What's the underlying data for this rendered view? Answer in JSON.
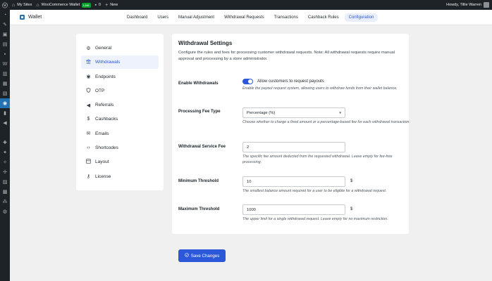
{
  "adminbar": {
    "my_sites": "My Sites",
    "site_name": "WooCommerce Wallet",
    "live_badge": "Live",
    "comments_count": "0",
    "new_label": "New",
    "howdy": "Howdy, Tillie Warren"
  },
  "plugin": {
    "title": "Wallet",
    "tabs": [
      {
        "label": "Dashboard"
      },
      {
        "label": "Users"
      },
      {
        "label": "Manual Adjustment"
      },
      {
        "label": "Withdrawal Requests"
      },
      {
        "label": "Transactions"
      },
      {
        "label": "Cashback Rules"
      },
      {
        "label": "Configuration"
      }
    ],
    "active_tab": "Configuration"
  },
  "sidebar": {
    "items": [
      {
        "label": "General",
        "icon": "gear-icon"
      },
      {
        "label": "Withdrawals",
        "icon": "bank-icon"
      },
      {
        "label": "Endpoints",
        "icon": "pin-icon"
      },
      {
        "label": "OTP",
        "icon": "shield-icon"
      },
      {
        "label": "Referrals",
        "icon": "megaphone-icon"
      },
      {
        "label": "Cashbacks",
        "icon": "dollar-icon"
      },
      {
        "label": "Emails",
        "icon": "envelope-icon"
      },
      {
        "label": "Shortcodes",
        "icon": "code-icon"
      },
      {
        "label": "Layout",
        "icon": "layout-icon"
      },
      {
        "label": "License",
        "icon": "key-icon"
      }
    ],
    "active": "Withdrawals"
  },
  "settings": {
    "title": "Withdrawal Settings",
    "description": "Configure the rules and fees for processing customer withdrawal requests. Note: All withdrawal requests require manual approval and processing by a store administrator.",
    "enable": {
      "label": "Enable Withdrawals",
      "toggle_label": "Allow customers to request payouts",
      "help": "Enable the payout request system, allowing users to withdraw funds from their wallet balance.",
      "checked": true
    },
    "fee_type": {
      "label": "Processing Fee Type",
      "value": "Percentage (%)",
      "help": "Choose whether to charge a fixed amount or a percentage-based fee for each withdrawal transaction."
    },
    "service_fee": {
      "label": "Withdrawal Service Fee",
      "value": "2",
      "help": "The specific fee amount deducted from the requested withdrawal. Leave empty for fee-free processing."
    },
    "min_threshold": {
      "label": "Minimum Threshold",
      "value": "10",
      "unit": "$",
      "help": "The smallest balance amount required for a user to be eligible for a withdrawal request."
    },
    "max_threshold": {
      "label": "Maximum Threshold",
      "value": "1000",
      "unit": "$",
      "help": "The upper limit for a single withdrawal request. Leave empty for no maximum restriction."
    }
  },
  "save_button": {
    "label": "Save Changes"
  },
  "colors": {
    "accent": "#2a58d8",
    "adminbar": "#1d2327",
    "active_menu": "#2271b1"
  }
}
